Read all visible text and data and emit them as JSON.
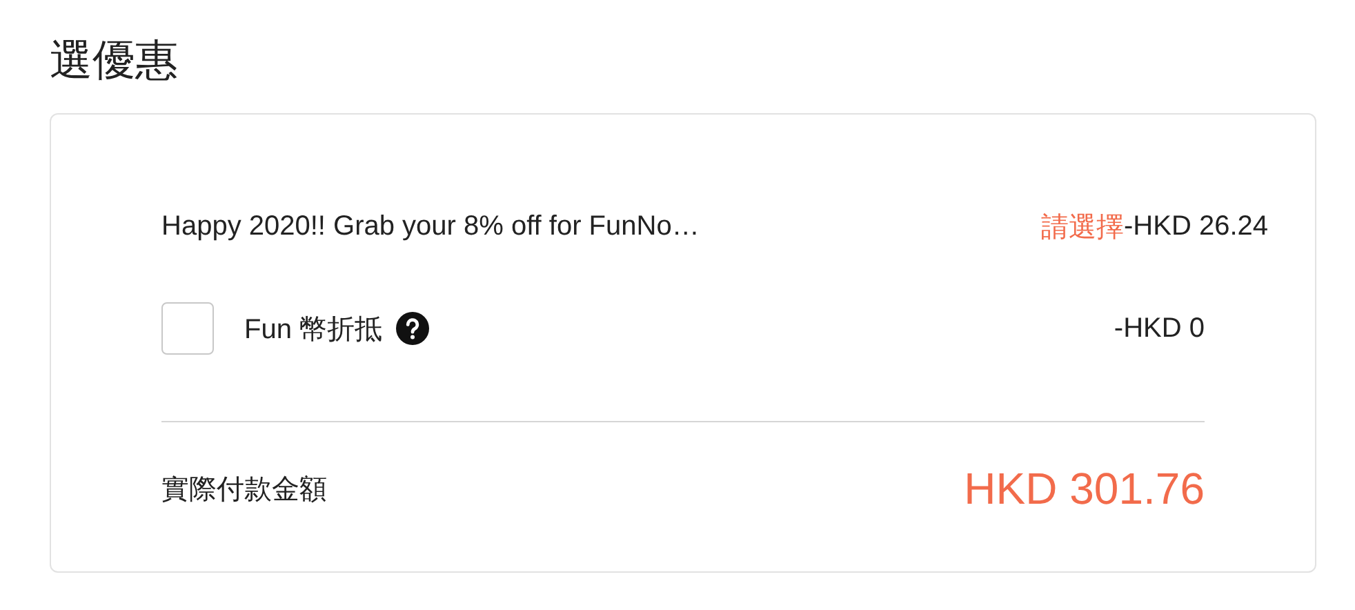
{
  "section_title": "選優惠",
  "promotion": {
    "name": "Happy 2020!! Grab your 8% off for FunNo…",
    "action": "請選擇",
    "amount": "-HKD 26.24"
  },
  "fun_coins": {
    "label": "Fun 幣折抵",
    "checked": false,
    "amount": "-HKD 0"
  },
  "total": {
    "label": "實際付款金額",
    "amount": "HKD 301.76"
  }
}
